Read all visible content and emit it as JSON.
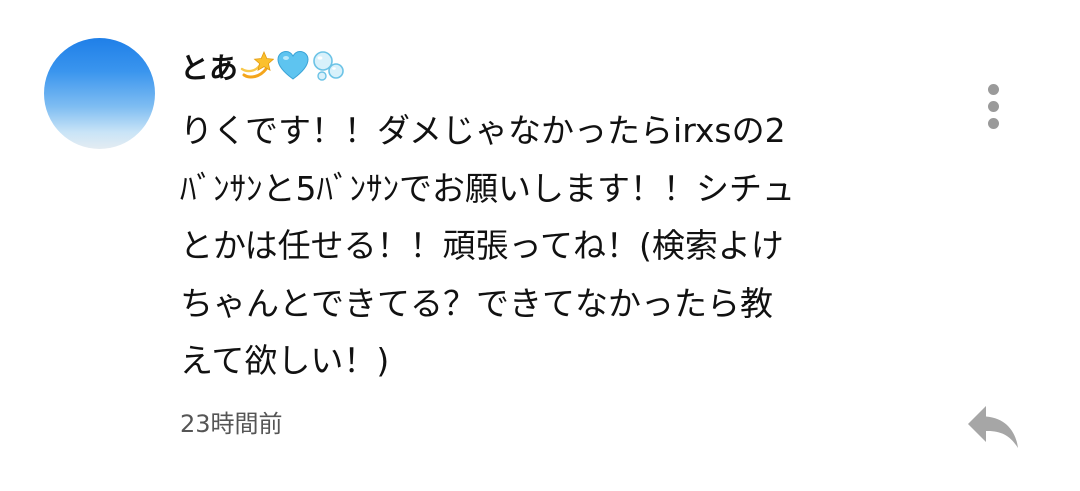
{
  "comment": {
    "author": {
      "name": "とあ",
      "emojis": [
        "dizzy-star-emoji",
        "blue-heart-emoji",
        "bubbles-emoji"
      ]
    },
    "body": "りくです！！ダメじゃなかったらirxsの2\nﾊﾞﾝｻﾝと5ﾊﾞﾝｻﾝでお願いします！！シチュ\nとかは任せる！！頑張ってね！(検索よけ\nちゃんとできてる？できてなかったら教\nえて欲しい！)",
    "timestamp": "23時間前",
    "icons": {
      "menu": "more-vertical-icon",
      "reply": "reply-icon"
    },
    "colors": {
      "icon_gray": "#9a9a9a",
      "text": "#111111",
      "timestamp": "#555555"
    }
  }
}
